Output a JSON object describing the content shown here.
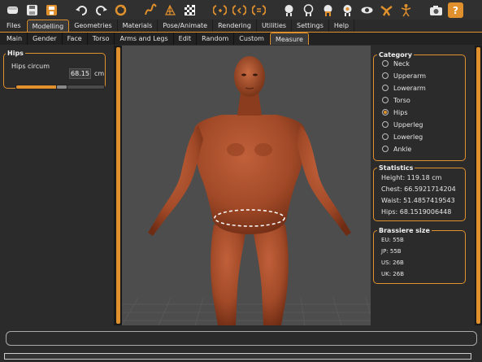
{
  "toolbar": {
    "icons": [
      "new-file-icon",
      "save-icon",
      "export-icon",
      "undo-icon",
      "redo-icon",
      "reset-icon",
      "smooth-icon",
      "wireframe-icon",
      "background-icon",
      "front-view-icon",
      "back-view-icon",
      "side-left-icon",
      "side-right-icon",
      "top-view-icon",
      "bottom-view-icon",
      "reset-camera-icon",
      "eye-icon",
      "pose-icon",
      "skeleton-icon",
      "screenshot-icon",
      "help-icon"
    ]
  },
  "main_tabs": [
    "Files",
    "Modelling",
    "Geometries",
    "Materials",
    "Pose/Animate",
    "Rendering",
    "Utilities",
    "Settings",
    "Help"
  ],
  "main_tab_active": "Modelling",
  "sub_tabs": [
    "Main",
    "Gender",
    "Face",
    "Torso",
    "Arms and Legs",
    "Edit",
    "Random",
    "Custom",
    "Measure"
  ],
  "sub_tab_active": "Measure",
  "hips_panel": {
    "title": "Hips",
    "slider_label": "Hips circum",
    "value": "68.15",
    "unit": "cm",
    "slider_fraction": 0.45
  },
  "category": {
    "title": "Category",
    "options": [
      "Neck",
      "Upperarm",
      "Lowerarm",
      "Torso",
      "Hips",
      "Upperleg",
      "Lowerleg",
      "Ankle"
    ],
    "selected": "Hips"
  },
  "statistics": {
    "title": "Statistics",
    "height": "Height: 119.18 cm",
    "chest": "Chest: 66.5921714204",
    "waist": "Waist: 51.4857419543",
    "hips": "Hips: 68.1519006448"
  },
  "brassiere": {
    "title": "Brassiere size",
    "eu": "EU: 55B",
    "jp": "JP: 55B",
    "us": "US: 26B",
    "uk": "UK: 26B"
  },
  "colors": {
    "accent": "#e0902c",
    "skin": "#a24a28",
    "viewport_bg": "#4d4d4d"
  }
}
